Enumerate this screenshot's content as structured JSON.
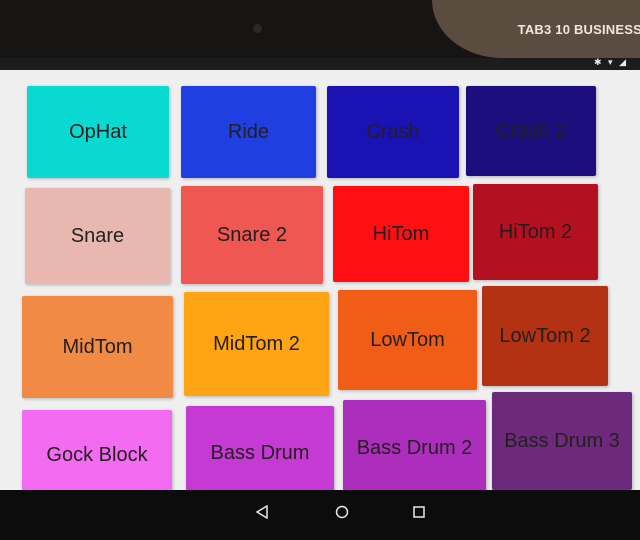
{
  "device": {
    "brand": "TAB3 10 BUSINESS",
    "status_icons": [
      "bluetooth-icon",
      "wifi-icon",
      "signal-icon"
    ]
  },
  "pads": [
    {
      "label": "OpHat",
      "color": "#0ad9d2"
    },
    {
      "label": "Ride",
      "color": "#1f3fe0"
    },
    {
      "label": "Crash",
      "color": "#1a12b2"
    },
    {
      "label": "Crash 2",
      "color": "#1c0f7d"
    },
    {
      "label": "Snare",
      "color": "#e7b7b0"
    },
    {
      "label": "Snare 2",
      "color": "#ee5752"
    },
    {
      "label": "HiTom",
      "color": "#ff0f12"
    },
    {
      "label": "HiTom 2",
      "color": "#b3111f"
    },
    {
      "label": "MidTom",
      "color": "#f08a44"
    },
    {
      "label": "MidTom 2",
      "color": "#ffa414"
    },
    {
      "label": "LowTom",
      "color": "#f05d16"
    },
    {
      "label": "LowTom 2",
      "color": "#b33213"
    },
    {
      "label": "Gock Block",
      "color": "#f26bf1"
    },
    {
      "label": "Bass Drum",
      "color": "#c53ad3"
    },
    {
      "label": "Bass Drum 2",
      "color": "#ad2dbc"
    },
    {
      "label": "Bass Drum 3",
      "color": "#6d2a7c"
    }
  ],
  "nav": {
    "back_icon": "back-triangle-icon",
    "home_icon": "home-circle-icon",
    "recents_icon": "recents-square-icon"
  }
}
